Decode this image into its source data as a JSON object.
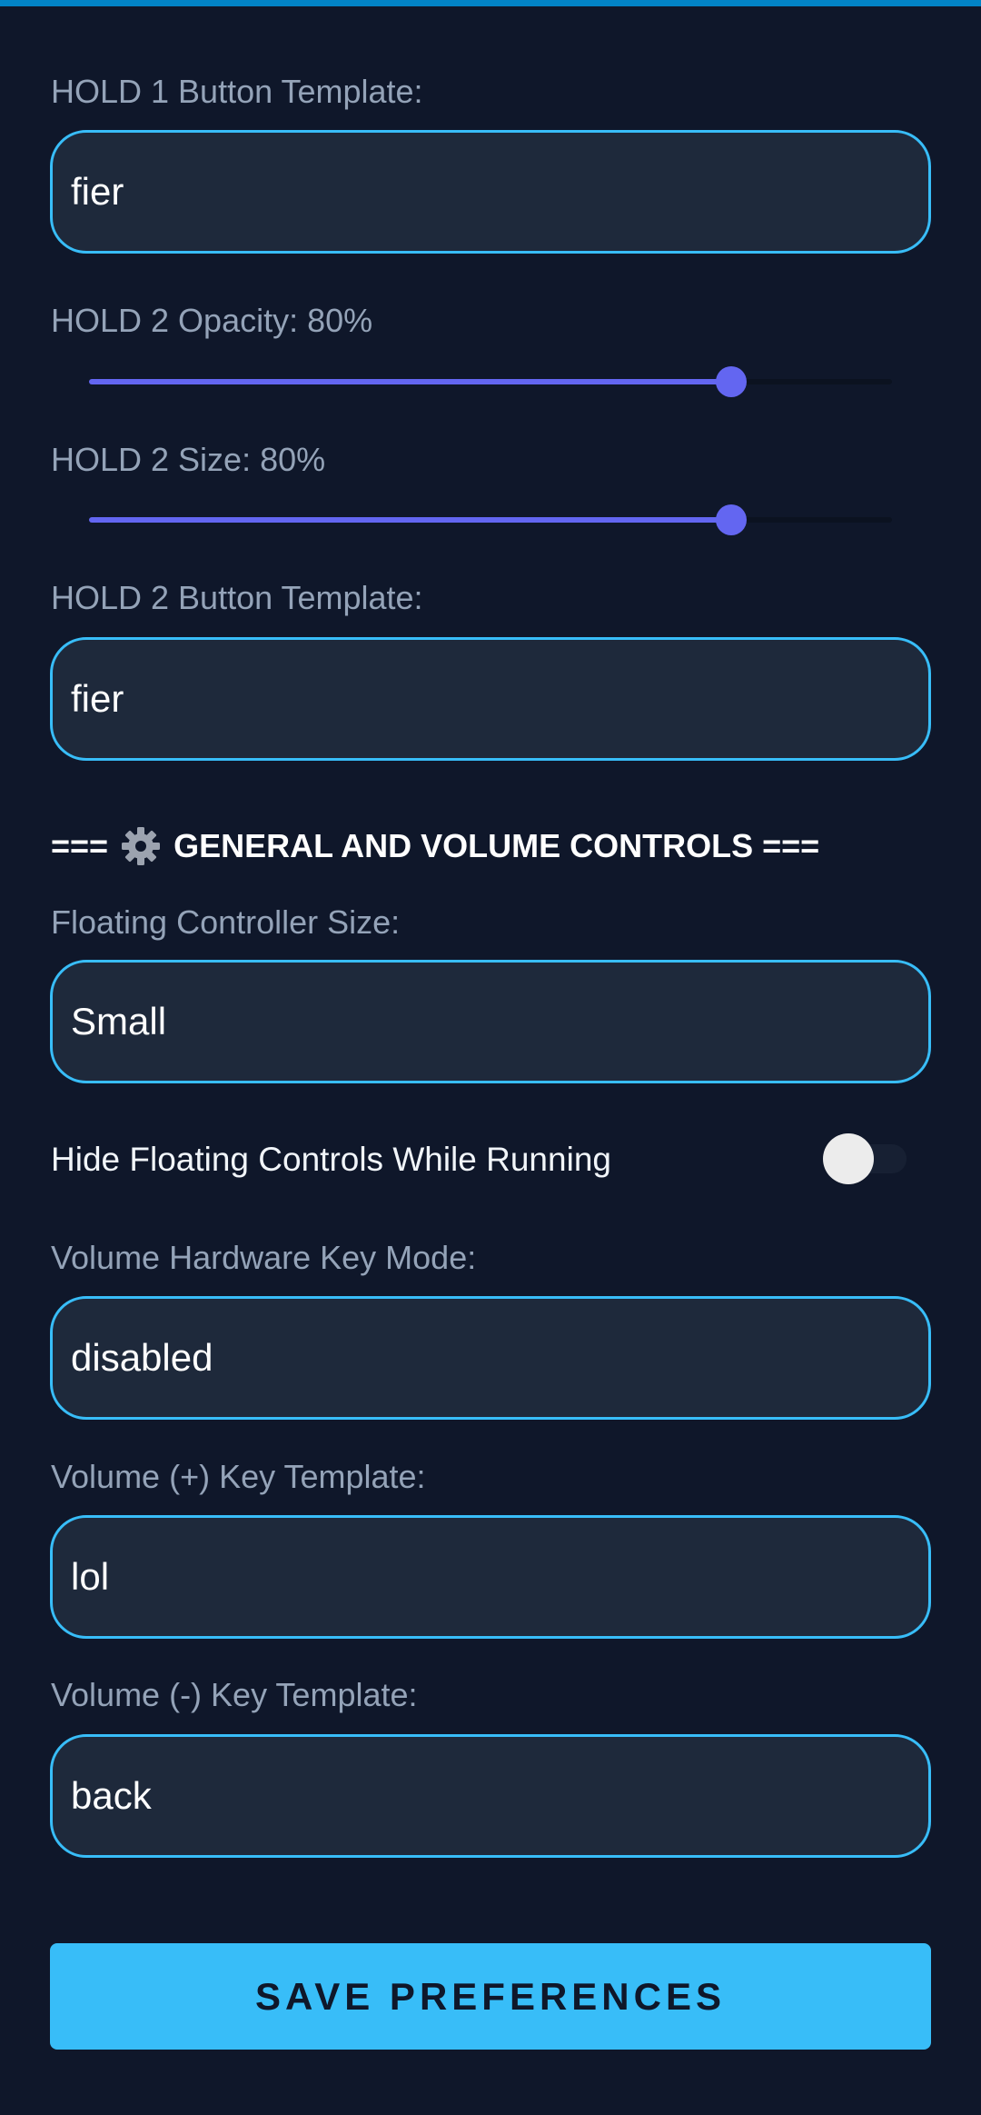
{
  "hold1": {
    "template_label": "HOLD 1 Button Template:",
    "template_value": "fier"
  },
  "hold2": {
    "opacity_label": "HOLD 2 Opacity: 80%",
    "opacity_percent": 80,
    "size_label": "HOLD 2 Size: 80%",
    "size_percent": 80,
    "template_label": "HOLD 2 Button Template:",
    "template_value": "fier"
  },
  "general": {
    "section_prefix": "===",
    "section_icon": "gear-icon",
    "section_title": "GENERAL AND VOLUME CONTROLS ===",
    "controller_size_label": "Floating Controller Size:",
    "controller_size_value": "Small",
    "hide_controls_label": "Hide Floating Controls While Running",
    "hide_controls_enabled": false,
    "volume_mode_label": "Volume Hardware Key Mode:",
    "volume_mode_value": "disabled",
    "volume_plus_label": "Volume (+) Key Template:",
    "volume_plus_value": "lol",
    "volume_minus_label": "Volume (-) Key Template:",
    "volume_minus_value": "back"
  },
  "actions": {
    "save_label": "SAVE PREFERENCES"
  },
  "colors": {
    "background": "#0f172a",
    "field_background": "#1e293b",
    "field_border": "#38bdf8",
    "slider_accent": "#6366f1",
    "primary_button": "#38bdf8",
    "top_accent": "#0284c7"
  }
}
